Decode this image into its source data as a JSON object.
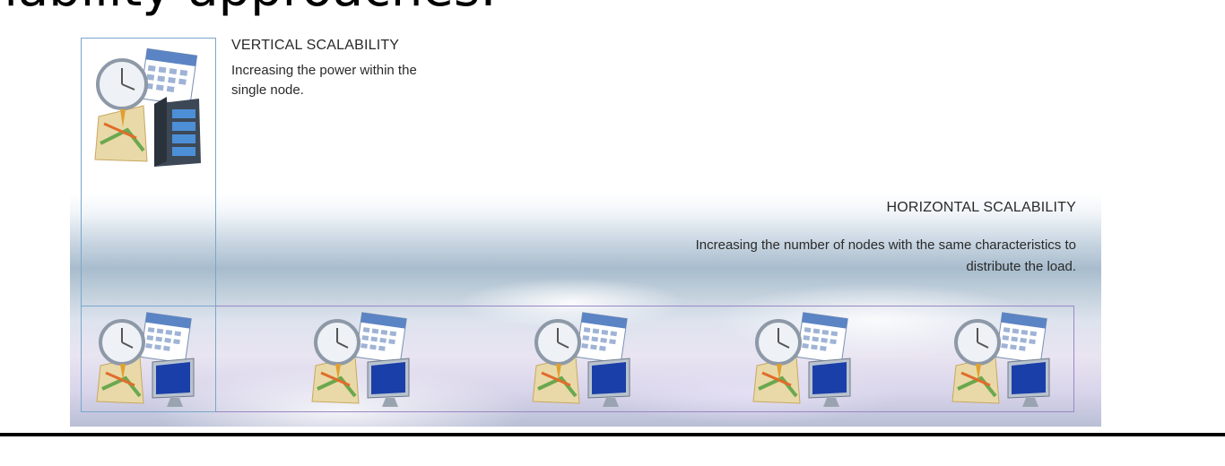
{
  "slide": {
    "title": "alability approaches:"
  },
  "vertical": {
    "title": "VERTICAL SCALABILITY",
    "description": "Increasing the power within the single node.",
    "icon": "server-calendar-clock-icon"
  },
  "horizontal": {
    "title": "HORIZONTAL SCALABILITY",
    "description": "Increasing the number of nodes with the same characteristics to distribute the load.",
    "node_icon": "workstation-calendar-clock-icon",
    "node_count": 5
  },
  "colors": {
    "vertical_border": "#7aa6cc",
    "horizontal_border": "#9a88c4",
    "text": "#2a2a2a"
  }
}
